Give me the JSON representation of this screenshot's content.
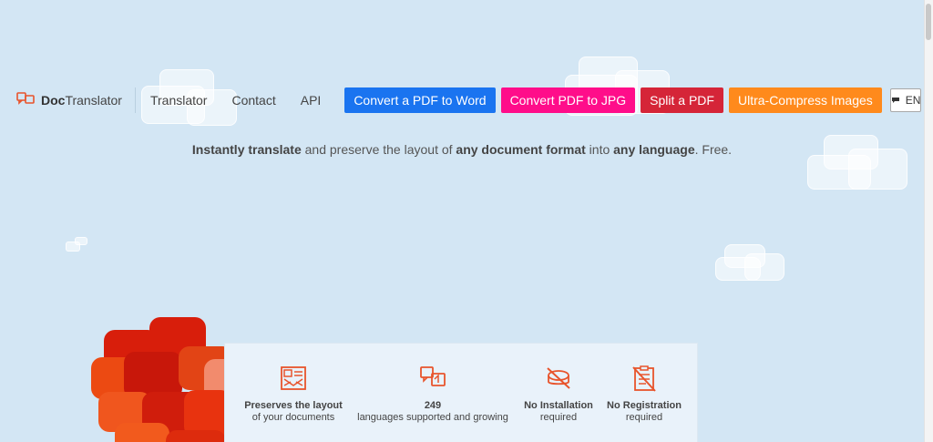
{
  "header": {
    "logo": {
      "brand_bold": "Doc",
      "brand_rest": "Translator",
      "icon": "translate-bubbles-icon"
    },
    "nav": [
      {
        "label": "Translator"
      },
      {
        "label": "Contact"
      },
      {
        "label": "API"
      }
    ],
    "ctas": [
      {
        "label": "Convert a PDF to Word",
        "color": "#1a74f0"
      },
      {
        "label": "Convert PDF to JPG",
        "color": "#ff0d8a"
      },
      {
        "label": "Split a PDF",
        "color": "#d52538"
      },
      {
        "label": "Ultra-Compress Images",
        "color": "#ff8a1c"
      }
    ],
    "language": {
      "label": "EN",
      "icon": "chat-bubble-icon"
    }
  },
  "tagline": {
    "part1": "Instantly translate",
    "part2": " and preserve the layout of ",
    "part3": "any document format",
    "part4": " into ",
    "part5": "any language",
    "part6": ". Free."
  },
  "features": [
    {
      "title": "Preserves the layout",
      "subtitle": "of your documents",
      "icon": "layout-document-icon"
    },
    {
      "title": "249",
      "subtitle": "languages supported and growing",
      "icon": "translate-arrows-icon"
    },
    {
      "title": "No Installation",
      "subtitle": "required",
      "icon": "no-install-icon"
    },
    {
      "title": "No Registration",
      "subtitle": "required",
      "icon": "no-registration-icon"
    }
  ],
  "colors": {
    "accent": "#e8542c",
    "background": "#d3e6f4"
  }
}
